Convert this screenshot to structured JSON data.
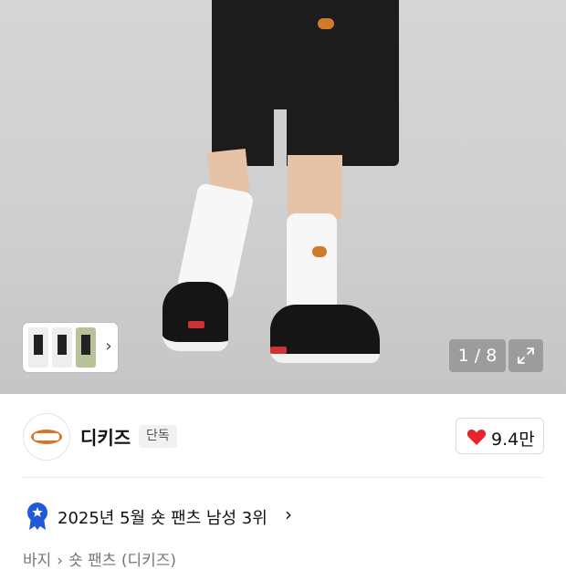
{
  "gallery": {
    "counter": "1 / 8",
    "icons": {
      "expand": "expand-icon",
      "next": "chevron-right-icon"
    }
  },
  "brand": {
    "name": "디키즈",
    "badge": "단독",
    "likes": "9.4만",
    "colors": {
      "heart": "#e8242c",
      "logo_orange": "#d8742a"
    }
  },
  "ranking": {
    "text": "2025년 5월 숏 팬츠 남성 3위",
    "arrow": "›",
    "badge_color": "#1f5bd8"
  },
  "breadcrumb": {
    "items": [
      "바지",
      "숏 팬츠 (디키즈)"
    ],
    "separator": "›"
  }
}
